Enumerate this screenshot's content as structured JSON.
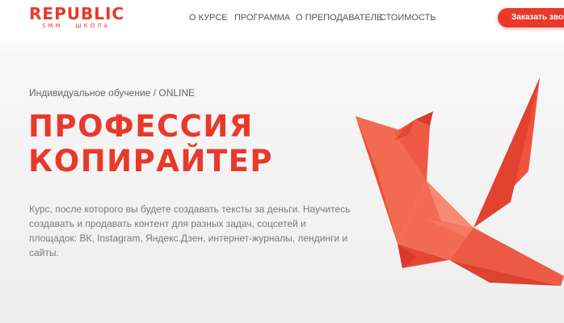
{
  "logo": {
    "name": "REPUBLIC",
    "tagline": "SMM · ШКОЛА"
  },
  "nav": {
    "items": [
      {
        "label": "О КУРСЕ"
      },
      {
        "label": "ПРОГРАММА"
      },
      {
        "label": "О ПРЕПОДАВАТЕЛЕ"
      },
      {
        "label": "СТОИМОСТЬ"
      }
    ]
  },
  "header": {
    "order_button_label": "Заказать звонок"
  },
  "hero": {
    "kicker": "Индивидуальное обучение / ONLINE",
    "title_line1": "ПРОФЕССИЯ",
    "title_line2": "КОПИРАЙТЕР",
    "description": "Курс, после которого вы будете создавать тексты за деньги. Научитесь создавать и продавать контент для разных задач, соцсетей и площадок: ВК, Instagram, Яндекс.Дзен, интернет-журналы, лендинги и сайты."
  },
  "illustration": {
    "icon": "origami-crane-icon"
  },
  "colors": {
    "accent": "#e8392b",
    "text_muted": "#7a7a7a",
    "nav_text": "#555555"
  }
}
